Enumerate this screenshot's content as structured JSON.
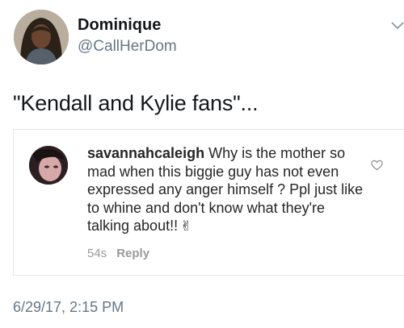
{
  "author": {
    "display_name": "Dominique",
    "handle": "@CallHerDom"
  },
  "tweet": {
    "text": "\"Kendall and Kylie fans\"...",
    "timestamp": "6/29/17, 2:15 PM"
  },
  "quoted_comment": {
    "username": "savannahcaleigh",
    "text": " Why is the mother so mad when this biggie guy has not even expressed any anger himself ? Ppl just like to whine and don't know what they're talking about!!",
    "emoji": "✌",
    "age": "54s",
    "reply_label": "Reply"
  },
  "icons": {
    "menu": "chevron-down-icon",
    "like": "heart-icon",
    "emoji": "victory-hand-icon"
  },
  "colors": {
    "text": "#14171a",
    "secondary": "#657786",
    "comment_meta": "#999999",
    "divider": "#e1e8ed"
  }
}
